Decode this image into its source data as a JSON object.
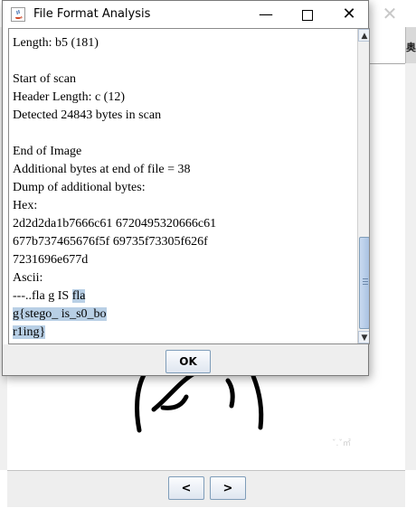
{
  "dialog": {
    "title": "File Format Analysis",
    "lines": [
      "Length: b5 (181)",
      "",
      "Start of scan",
      "Header Length: c (12)",
      "Detected 24843 bytes in scan",
      "",
      "End of Image",
      "Additional bytes at end of file = 38",
      "Dump of additional bytes:",
      "Hex:",
      "2d2d2da1b7666c61 6720495320666c61",
      "677b737465676f5f 69735f73305f626f",
      "7231696e677d",
      "Ascii:"
    ],
    "ascii_line1_plain": "---..fla g IS ",
    "ascii_line1_selected": "fla",
    "ascii_line2_selected": "g{stego_ is_s0_bo",
    "ascii_line3_selected": "r1ing}",
    "ok_label": "OK"
  },
  "background": {
    "close_glyph": "✕",
    "sidebar_glyph": "奥",
    "watermark": "ˇ.ˇ㎡",
    "prev_label": "<",
    "next_label": ">"
  },
  "colors": {
    "selection": "#b8cfe5",
    "button_border": "#7f9db9",
    "scroll_thumb": "#a9c2e2"
  },
  "icons": {
    "window_icon": "java-coffee-icon",
    "minimize": "minimize-icon",
    "maximize": "maximize-icon",
    "close": "close-icon"
  }
}
